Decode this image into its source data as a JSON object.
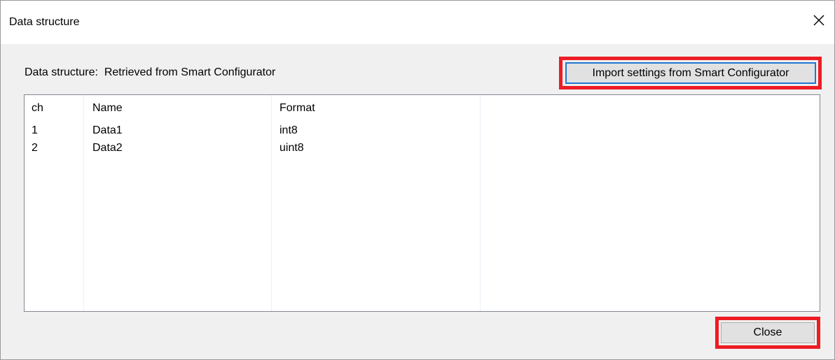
{
  "window": {
    "title": "Data structure"
  },
  "info": {
    "label": "Data structure:  Retrieved from Smart Configurator"
  },
  "buttons": {
    "import_label": "Import settings from Smart Configurator",
    "close_label": "Close"
  },
  "table": {
    "columns": [
      "ch",
      "Name",
      "Format"
    ],
    "rows": [
      {
        "ch": "1",
        "name": "Data1",
        "format": "int8"
      },
      {
        "ch": "2",
        "name": "Data2",
        "format": "uint8"
      }
    ]
  },
  "colors": {
    "highlight": "#ee1c24",
    "focus_border": "#1f78d1",
    "dialog_bg": "#f0f0f0"
  },
  "icons": {
    "window_close": "close-icon"
  }
}
